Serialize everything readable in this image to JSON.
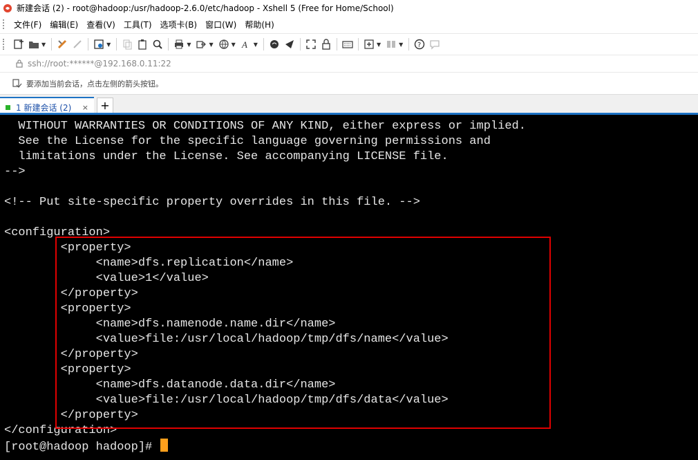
{
  "window": {
    "title": "新建会话 (2) - root@hadoop:/usr/hadoop-2.6.0/etc/hadoop - Xshell 5 (Free for Home/School)"
  },
  "menu": {
    "items": [
      {
        "label": "文件(F)"
      },
      {
        "label": "编辑(E)"
      },
      {
        "label": "查看(V)"
      },
      {
        "label": "工具(T)"
      },
      {
        "label": "选项卡(B)"
      },
      {
        "label": "窗口(W)"
      },
      {
        "label": "帮助(H)"
      }
    ]
  },
  "address": {
    "value": "ssh://root:******@192.168.0.11:22"
  },
  "hint": {
    "text": "要添加当前会话，点击左侧的箭头按钮。"
  },
  "tabs": {
    "active_label": "1 新建会话 (2)",
    "close_glyph": "×",
    "new_tab_glyph": "+"
  },
  "terminal": {
    "lines": [
      "  WITHOUT WARRANTIES OR CONDITIONS OF ANY KIND, either express or implied.",
      "  See the License for the specific language governing permissions and",
      "  limitations under the License. See accompanying LICENSE file.",
      "-->",
      "",
      "<!-- Put site-specific property overrides in this file. -->",
      "",
      "<configuration>",
      "        <property>",
      "             <name>dfs.replication</name>",
      "             <value>1</value>",
      "        </property>",
      "        <property>",
      "             <name>dfs.namenode.name.dir</name>",
      "             <value>file:/usr/local/hadoop/tmp/dfs/name</value>",
      "        </property>",
      "        <property>",
      "             <name>dfs.datanode.data.dir</name>",
      "             <value>file:/usr/local/hadoop/tmp/dfs/data</value>",
      "        </property>",
      "</configuration>",
      "[root@hadoop hadoop]# "
    ]
  },
  "colors": {
    "terminal_bg": "#000000",
    "terminal_fg": "#e6e6e6",
    "cursor": "#ff9f1c",
    "highlight": "#e00000",
    "accent": "#1d72c4"
  }
}
